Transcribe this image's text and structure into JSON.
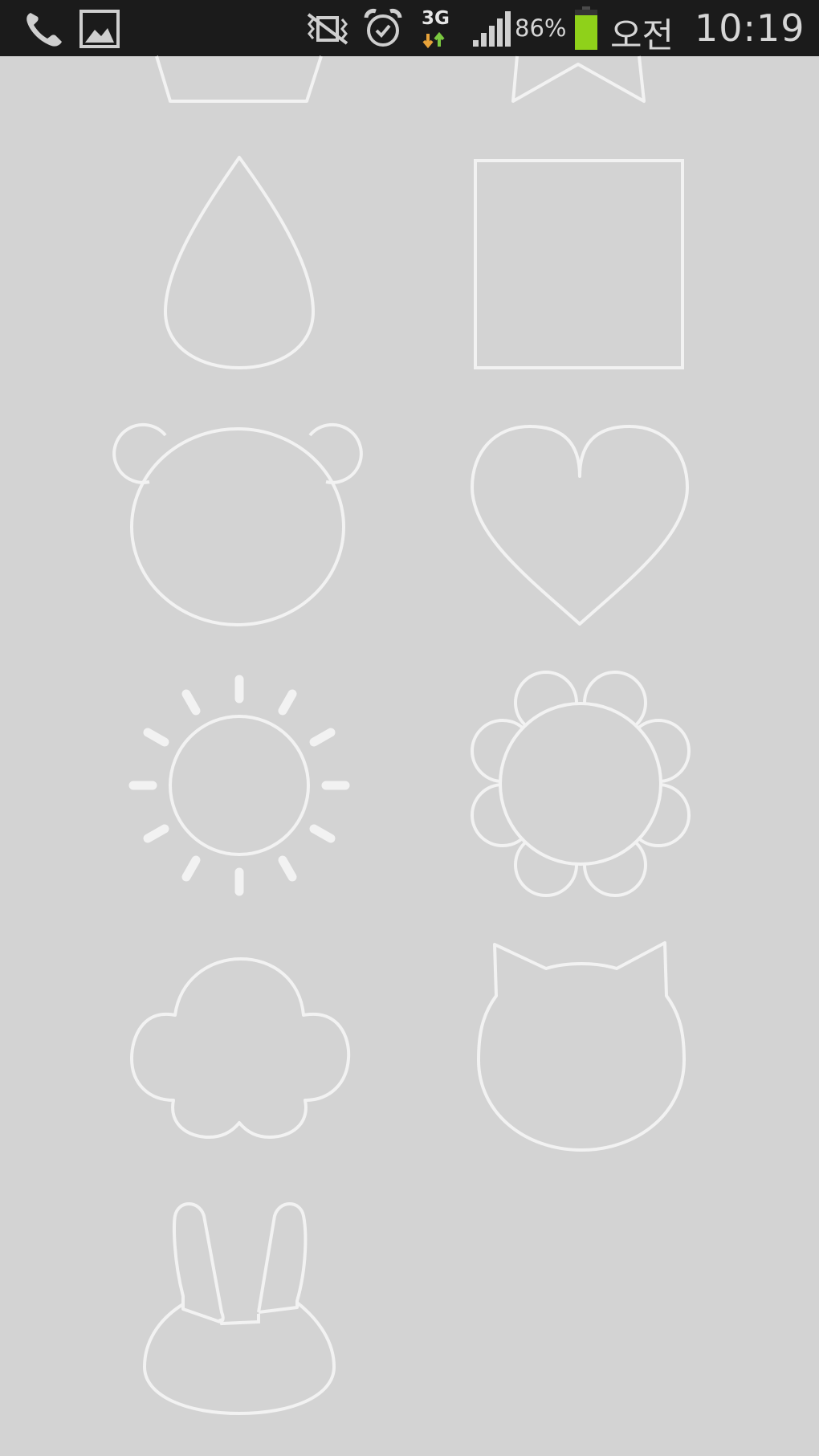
{
  "status_bar": {
    "network": "3G",
    "battery_percent": "86%",
    "ampm": "오전",
    "time": "10:19",
    "battery_level": 0.86,
    "colors": {
      "background": "#1b1b1b",
      "icon": "#cfcfcf",
      "battery_fill": "#8fd11a",
      "net_up_arrow": "#7bc940",
      "net_down_arrow": "#e8a33a"
    },
    "icons": [
      "phone-icon",
      "gallery-icon",
      "vibrate-icon",
      "alarm-icon",
      "network-3g-icon",
      "signal-icon",
      "battery-icon"
    ]
  },
  "shape_picker": {
    "background_color": "#d3d3d3",
    "stroke_color": "#f2f2f2",
    "shapes": [
      "pentagon",
      "ribbon",
      "drop",
      "square",
      "bear",
      "heart",
      "sun",
      "flower",
      "cloud",
      "cat",
      "rabbit"
    ]
  }
}
